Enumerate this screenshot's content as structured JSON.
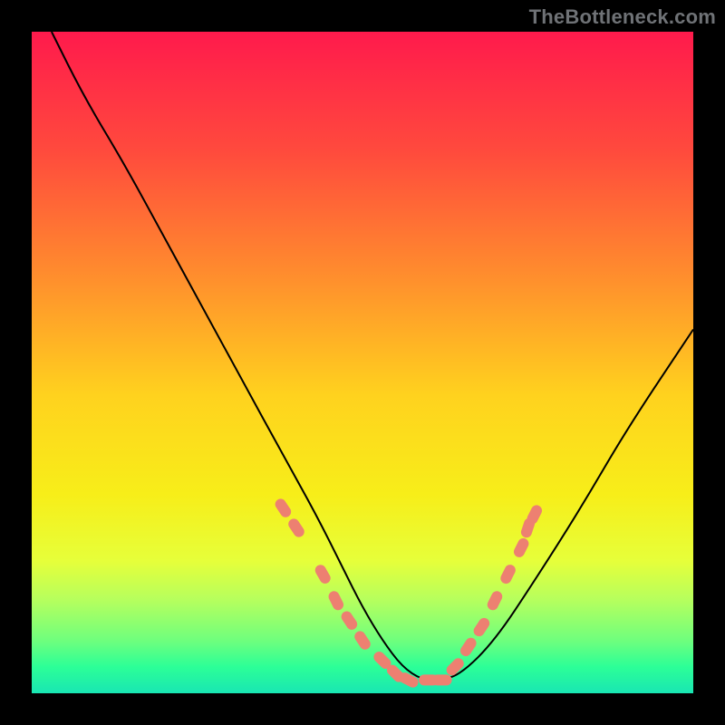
{
  "watermark": "TheBottleneck.com",
  "colors": {
    "frame": "#000000",
    "curve": "#000000",
    "markers": "#ed8071",
    "watermark_text": "#6f7276",
    "gradient_stops": [
      "#ff1a4c",
      "#ff4a3d",
      "#ff8a2e",
      "#ffd21e",
      "#f7ee19",
      "#e6ff3a",
      "#b5ff5e",
      "#6fff7d",
      "#2cff97",
      "#19e6b3"
    ]
  },
  "chart_data": {
    "type": "line",
    "title": "",
    "xlabel": "",
    "ylabel": "",
    "xlim": [
      0,
      100
    ],
    "ylim": [
      0,
      100
    ],
    "grid": false,
    "legend": false,
    "series": [
      {
        "name": "bottleneck-curve",
        "x": [
          3,
          8,
          14,
          20,
          26,
          32,
          38,
          43,
          47,
          50,
          53,
          56,
          59,
          62,
          65,
          70,
          76,
          83,
          90,
          100
        ],
        "y": [
          100,
          90,
          80,
          69,
          58,
          47,
          36,
          27,
          19,
          13,
          8,
          4,
          2,
          2,
          3,
          8,
          17,
          28,
          40,
          55
        ]
      }
    ],
    "markers": {
      "name": "highlight-segments",
      "xy": [
        [
          38,
          28
        ],
        [
          40,
          25
        ],
        [
          44,
          18
        ],
        [
          46,
          14
        ],
        [
          48,
          11
        ],
        [
          50,
          8
        ],
        [
          53,
          5
        ],
        [
          55,
          3
        ],
        [
          57,
          2
        ],
        [
          60,
          2
        ],
        [
          62,
          2
        ],
        [
          64,
          4
        ],
        [
          66,
          7
        ],
        [
          68,
          10
        ],
        [
          70,
          14
        ],
        [
          72,
          18
        ],
        [
          74,
          22
        ],
        [
          75,
          25
        ],
        [
          76,
          27
        ]
      ]
    }
  }
}
